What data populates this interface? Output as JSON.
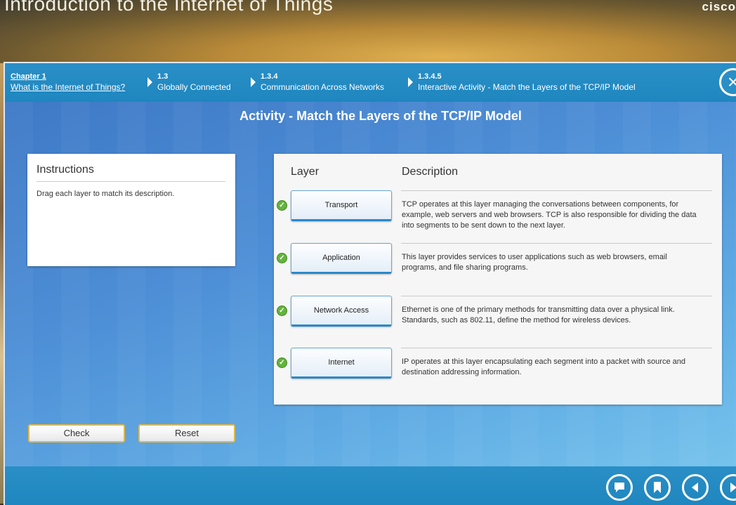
{
  "banner": {
    "title": "Introduction to the Internet of Things",
    "logo": "cisco"
  },
  "breadcrumb": [
    {
      "num": "Chapter 1",
      "label": "What is the Internet of Things?",
      "link": true
    },
    {
      "num": "1.3",
      "label": "Globally Connected",
      "link": false
    },
    {
      "num": "1.3.4",
      "label": "Communication Across Networks",
      "link": false
    },
    {
      "num": "1.3.4.5",
      "label": "Interactive Activity - Match the Layers of the TCP/IP Model",
      "link": false
    }
  ],
  "activity_title": "Activity - Match the Layers of the TCP/IP Model",
  "instructions": {
    "title": "Instructions",
    "text": "Drag each layer to match its description."
  },
  "table": {
    "col_layer": "Layer",
    "col_description": "Description",
    "rows": [
      {
        "layer": "Transport",
        "correct": true,
        "description": "TCP operates at this layer managing the conversations between components, for example, web servers and web browsers. TCP is also responsible for dividing the data into segments to be sent down to the next layer."
      },
      {
        "layer": "Application",
        "correct": true,
        "description": "This layer provides services to user applications such as web browsers, email programs, and file sharing programs."
      },
      {
        "layer": "Network Access",
        "correct": true,
        "description": "Ethernet is one of the primary methods for transmitting data over a physical link. Standards, such as 802.11, define the method for wireless devices."
      },
      {
        "layer": "Internet",
        "correct": true,
        "description": "IP operates at this layer encapsulating each segment into a packet with source and destination addressing information."
      }
    ]
  },
  "buttons": {
    "check": "Check",
    "reset": "Reset"
  },
  "footer_icons": [
    "comment-icon",
    "bookmark-icon",
    "previous-icon",
    "next-icon"
  ],
  "colors": {
    "header_blue": "#2a8fc6",
    "check_green": "#64b43c",
    "button_border": "#e2b84a"
  }
}
